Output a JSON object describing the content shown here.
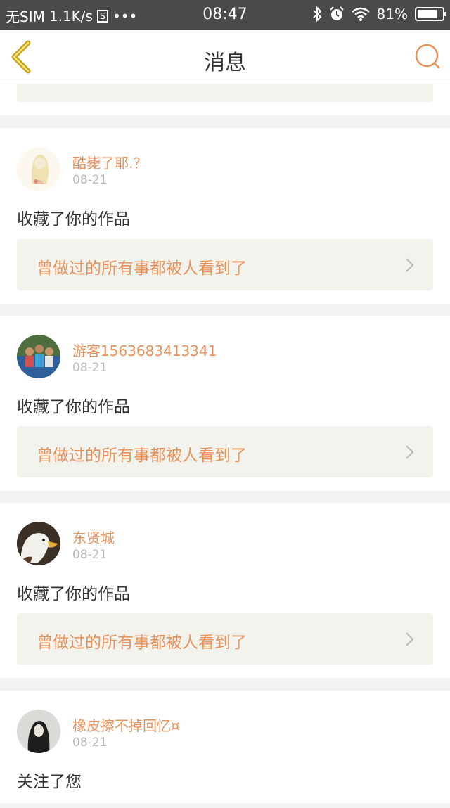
{
  "status_bar": {
    "carrier": "无SIM",
    "speed": "1.1K/s",
    "s_icon": "S",
    "dots": "•••",
    "time": "08:47",
    "battery": "81%",
    "battery_level": 0.81
  },
  "nav": {
    "title": "消息"
  },
  "messages": [
    {
      "username": "酷毙了耶.？",
      "date": "08-21",
      "action": "收藏了你的作品",
      "work_title": "曾做过的所有事都被人看到了"
    },
    {
      "username": "游客1563683413341",
      "date": "08-21",
      "action": "收藏了你的作品",
      "work_title": "曾做过的所有事都被人看到了"
    },
    {
      "username": "东贤城",
      "date": "08-21",
      "action": "收藏了你的作品",
      "work_title": "曾做过的所有事都被人看到了"
    },
    {
      "username": "橡皮擦不掉回忆¤",
      "date": "08-21",
      "action": "关注了您"
    }
  ],
  "colors": {
    "accent": "#e8915a",
    "back_icon": "#c9a21b",
    "card_bg": "#f3f3ee"
  }
}
